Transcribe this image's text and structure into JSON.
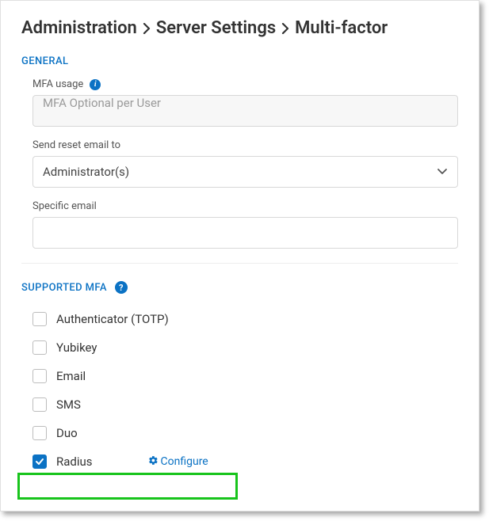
{
  "breadcrumb": {
    "item1": "Administration",
    "item2": "Server Settings",
    "item3": "Multi-factor"
  },
  "sections": {
    "general": {
      "title": "GENERAL",
      "mfa_usage": {
        "label": "MFA usage",
        "value": "MFA Optional per User"
      },
      "send_reset": {
        "label": "Send reset email to",
        "value": "Administrator(s)"
      },
      "specific_email": {
        "label": "Specific email",
        "value": ""
      }
    },
    "supported": {
      "title": "SUPPORTED MFA",
      "options": [
        {
          "label": "Authenticator (TOTP)",
          "checked": false
        },
        {
          "label": "Yubikey",
          "checked": false
        },
        {
          "label": "Email",
          "checked": false
        },
        {
          "label": "SMS",
          "checked": false
        },
        {
          "label": "Duo",
          "checked": false
        },
        {
          "label": "Radius",
          "checked": true,
          "configure": "Configure"
        }
      ]
    }
  }
}
